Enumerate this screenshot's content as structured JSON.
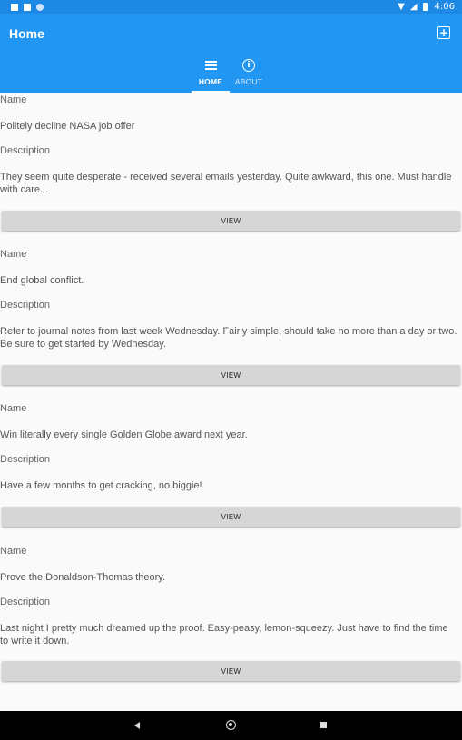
{
  "status_bar": {
    "time": "4:06"
  },
  "app_bar": {
    "title": "Home",
    "add_icon": "add-box-icon"
  },
  "tabs": [
    {
      "label": "HOME",
      "icon": "menu-icon",
      "active": true
    },
    {
      "label": "ABOUT",
      "icon": "info-icon",
      "active": false
    }
  ],
  "items": [
    {
      "name_label": "Name",
      "name": "Politely decline NASA job offer",
      "description_label": "Description",
      "description": "They seem quite desperate - received several emails yesterday. Quite awkward, this one. Must handle with care...",
      "button": "VIEW"
    },
    {
      "name_label": "Name",
      "name": "End global conflict.",
      "description_label": "Description",
      "description": "Refer to journal notes from last week Wednesday. Fairly simple, should take no more than a day or two. Be sure to get started by Wednesday.",
      "button": "VIEW"
    },
    {
      "name_label": "Name",
      "name": "Win literally every single Golden Globe award next year.",
      "description_label": "Description",
      "description": "Have a few months to get cracking, no biggie!",
      "button": "VIEW"
    },
    {
      "name_label": "Name",
      "name": "Prove the Donaldson-Thomas theory.",
      "description_label": "Description",
      "description": "Last night I pretty much dreamed up the proof. Easy-peasy, lemon-squeezy. Just have to find the time to write it down.",
      "button": "VIEW"
    }
  ],
  "colors": {
    "primary": "#2196f3",
    "status_bar": "#1e88e5",
    "button": "#d6d6d6",
    "background": "#fafafa"
  }
}
